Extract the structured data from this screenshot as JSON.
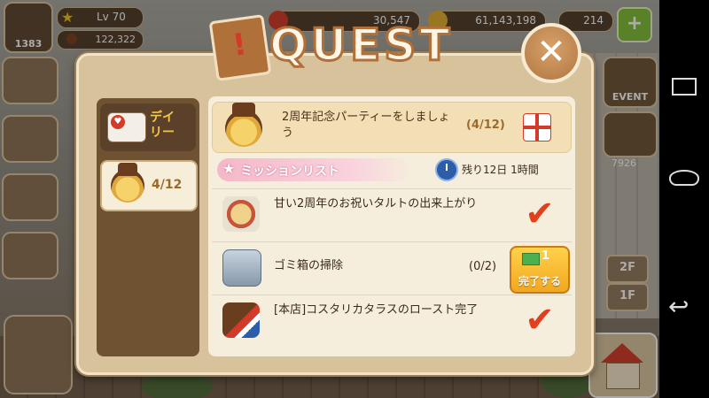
{
  "hud": {
    "level_box_count": "1383",
    "level": "Lv 70",
    "beans": "122,322",
    "hearts": "30,547",
    "coins": "61,143,198",
    "gems": "214",
    "side_count": "7926",
    "event_label": "EVENT",
    "floor_2": "2F",
    "floor_1": "1F"
  },
  "quest": {
    "title": "QUEST",
    "close_symbol": "✕",
    "tabs": [
      {
        "label": "デイ\nリー",
        "badge": "daily",
        "icon": "daily-heart-badge-icon"
      },
      {
        "label": "4/12",
        "icon": "cafe-mascot-icon"
      }
    ],
    "header": {
      "title": "2周年記念パーティーをしましょう",
      "progress": "(4/12)",
      "reward_icon": "gift-box-icon"
    },
    "mission_list_label": "ミッションリスト",
    "timer_label": "残り12日 1時間",
    "missions": [
      {
        "text": "甘い2周年のお祝いタルトの出来上がり",
        "status": "completed",
        "icon": "tart-icon"
      },
      {
        "text": "ゴミ箱の掃除",
        "count": "(0/2)",
        "status": "action",
        "button_num": "1",
        "button_label": "完了する",
        "icon": "trash-bin-icon"
      },
      {
        "text": "[本店]コスタリカタラスのロースト完了",
        "status": "completed",
        "icon": "coffee-roast-icon"
      }
    ]
  },
  "colors": {
    "panel_bg": "#d8c29c",
    "content_bg": "#f6eedc",
    "accent_orange": "#f0a820",
    "check_red": "#e0401e",
    "tab_column": "#6e5232"
  }
}
